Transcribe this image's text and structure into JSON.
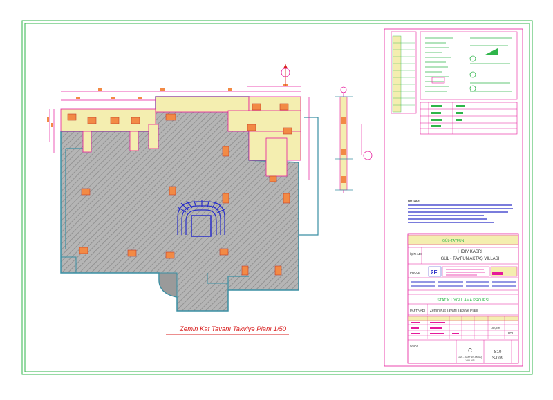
{
  "plan_caption": "Zemin Kat Tavanı Takviye Planı  1/50",
  "title_block": {
    "header_code": "GÜL-TAYFUN",
    "notes_label": "İŞİN ADI",
    "project_name_line1": "HIDIV KASRI",
    "project_name_line2": "GÜL - TAYFUN AKTAŞ VİLLASI",
    "project_label": "PROJE",
    "logo_text": "2F",
    "section_title": "STATİK UYGULAMA PROJESİ",
    "pafta_label": "PAFTA ADI",
    "pafta_name": "Zemin Kat Tavanı Takviye Planı",
    "scale_label": "ÖLÇEK",
    "scale_value": "1/50",
    "onay_label": "ONAY",
    "block_letter": "C",
    "block_sub": "GÜL - TAYFUN AKTAŞ",
    "block_sub2": "VİLLASI",
    "sheet_no": "S10",
    "sheet_code": "S-009",
    "dash": "-"
  },
  "notes_heading": "NOTLAR:",
  "colors": {
    "border": "#2fb54a",
    "magenta": "#e6199b",
    "hatch": "#7d7d7d",
    "slab_fill": "#b9b9b9",
    "yellow": "#f4eeb0",
    "orange": "#f28a45",
    "stair_blue": "#2a2fc8",
    "teal": "#3a8fa3",
    "red": "#d81e1e"
  }
}
